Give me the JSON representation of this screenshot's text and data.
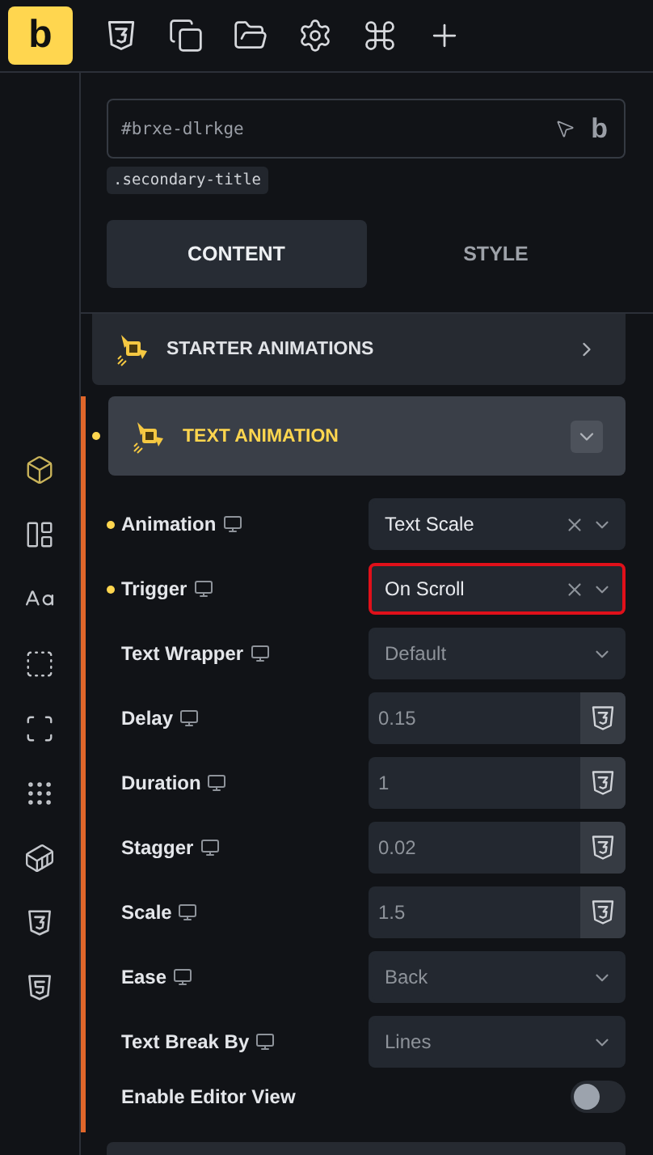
{
  "topbar": {
    "logo": "b",
    "tools": [
      {
        "kind": "css"
      },
      {
        "kind": "pages"
      },
      {
        "kind": "folder"
      },
      {
        "kind": "settings"
      },
      {
        "kind": "command"
      },
      {
        "kind": "add"
      }
    ]
  },
  "sidebar": {
    "items": [
      {
        "kind": "element",
        "selected": true
      },
      {
        "kind": "layout",
        "selected": false
      },
      {
        "kind": "typography",
        "selected": false
      },
      {
        "kind": "spacing",
        "selected": false
      },
      {
        "kind": "border",
        "selected": false
      },
      {
        "kind": "grid",
        "selected": false
      },
      {
        "kind": "transform",
        "selected": false
      },
      {
        "kind": "css",
        "selected": false
      },
      {
        "kind": "html",
        "selected": false
      }
    ]
  },
  "selector": {
    "value": "#brxe-dlrkge",
    "badge": "b",
    "class_tag": ".secondary-title"
  },
  "tabs": [
    {
      "label": "CONTENT",
      "selected": true
    },
    {
      "label": "STYLE",
      "selected": false
    }
  ],
  "sections": [
    {
      "title": "STARTER ANIMATIONS",
      "expanded": false,
      "modified": false
    },
    {
      "title": "TEXT ANIMATION",
      "expanded": true,
      "modified": true
    }
  ],
  "fields": [
    {
      "kind": "select",
      "label": "Animation",
      "modified": true,
      "value": "Text Scale",
      "clearable": true,
      "highlighted": false
    },
    {
      "kind": "select",
      "label": "Trigger",
      "modified": true,
      "value": "On Scroll",
      "clearable": true,
      "highlighted": true
    },
    {
      "kind": "select",
      "label": "Text Wrapper",
      "modified": false,
      "placeholder": "Default",
      "clearable": false,
      "highlighted": false
    },
    {
      "kind": "number",
      "label": "Delay",
      "modified": false,
      "placeholder": "0.15"
    },
    {
      "kind": "number",
      "label": "Duration",
      "modified": false,
      "placeholder": "1"
    },
    {
      "kind": "number",
      "label": "Stagger",
      "modified": false,
      "placeholder": "0.02"
    },
    {
      "kind": "number",
      "label": "Scale",
      "modified": false,
      "placeholder": "1.5"
    },
    {
      "kind": "select",
      "label": "Ease",
      "modified": false,
      "placeholder": "Back",
      "clearable": false,
      "highlighted": false
    },
    {
      "kind": "select",
      "label": "Text Break By",
      "modified": false,
      "placeholder": "Lines",
      "clearable": false,
      "highlighted": false
    },
    {
      "kind": "toggle",
      "label": "Enable Editor View",
      "modified": false,
      "on": false
    }
  ]
}
